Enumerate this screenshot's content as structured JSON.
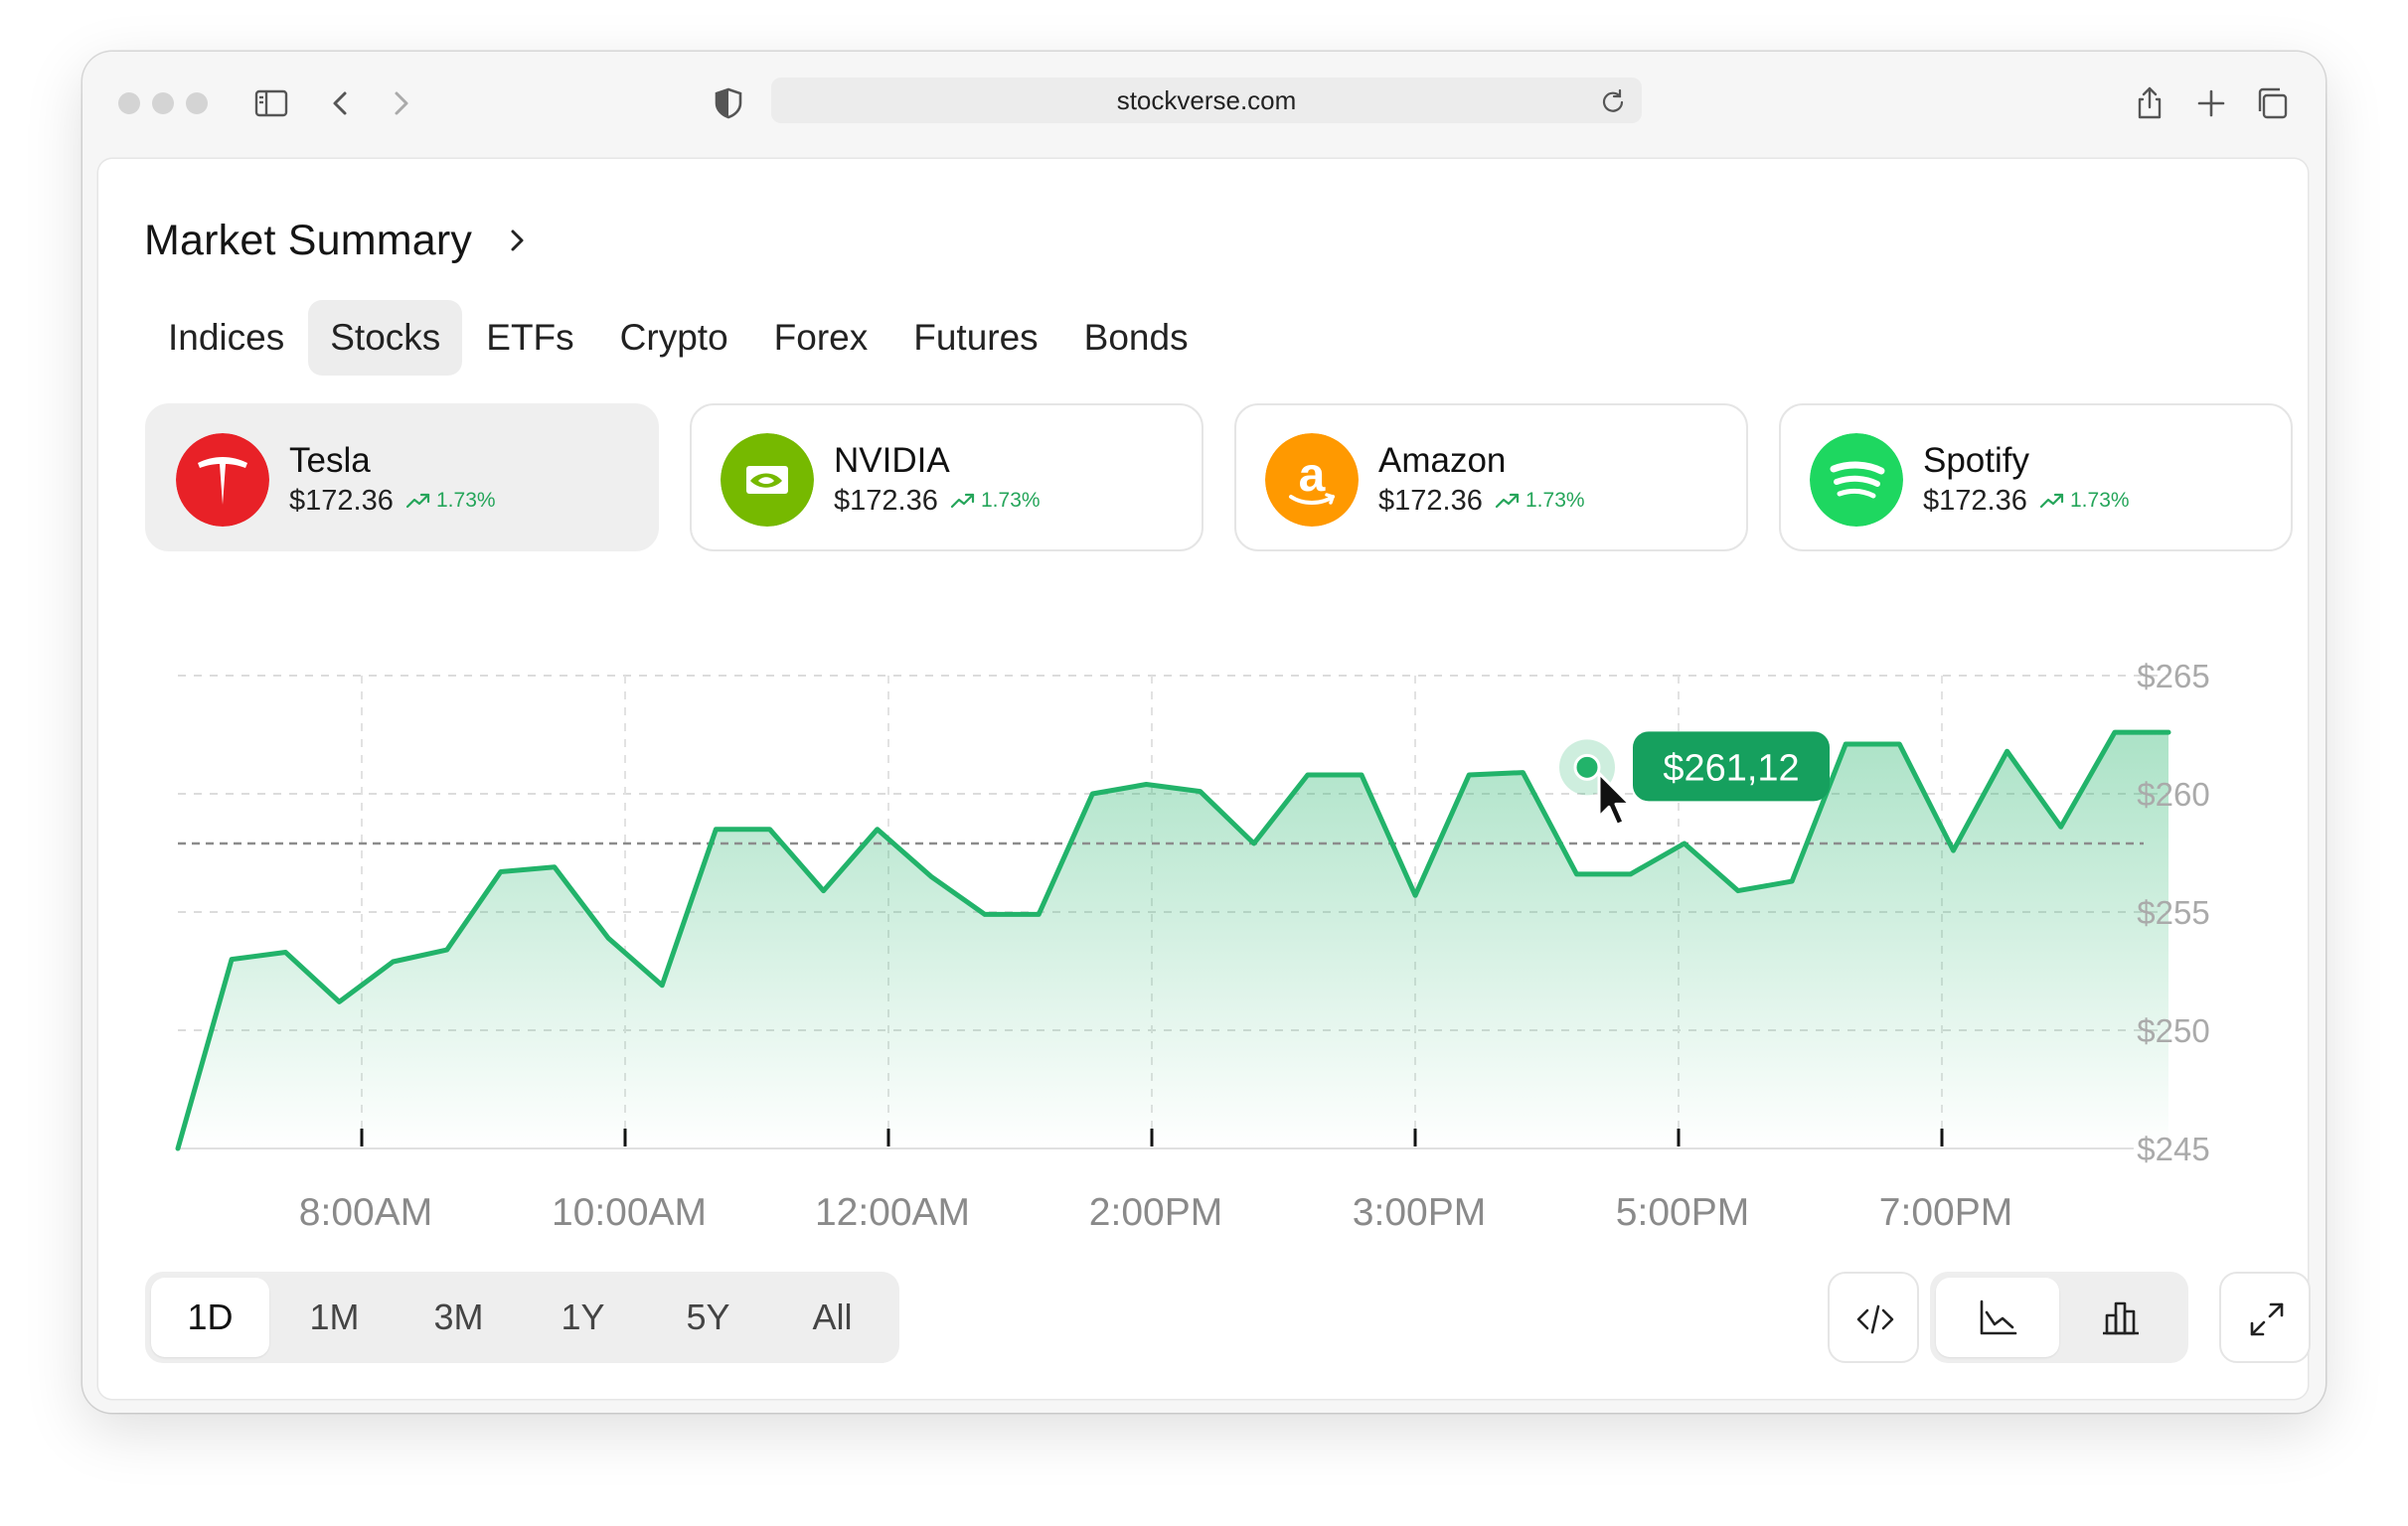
{
  "browser": {
    "url": "stockverse.com",
    "icons": [
      "sidebar-icon",
      "back-icon",
      "forward-icon",
      "shield-icon",
      "reload-icon",
      "share-icon",
      "new-tab-icon",
      "tabs-overview-icon"
    ]
  },
  "page": {
    "title": "Market Summary",
    "tabs": [
      {
        "label": "Indices",
        "active": false
      },
      {
        "label": "Stocks",
        "active": true
      },
      {
        "label": "ETFs",
        "active": false
      },
      {
        "label": "Crypto",
        "active": false
      },
      {
        "label": "Forex",
        "active": false
      },
      {
        "label": "Futures",
        "active": false
      },
      {
        "label": "Bonds",
        "active": false
      }
    ]
  },
  "stocks": [
    {
      "name": "Tesla",
      "price": "$172.36",
      "change": "1.73%",
      "logo": "tesla-logo",
      "color": "#e82127",
      "active": true
    },
    {
      "name": "NVIDIA",
      "price": "$172.36",
      "change": "1.73%",
      "logo": "nvidia-logo",
      "color": "#76b900",
      "active": false
    },
    {
      "name": "Amazon",
      "price": "$172.36",
      "change": "1.73%",
      "logo": "amazon-logo",
      "color": "#ff9900",
      "active": false
    },
    {
      "name": "Spotify",
      "price": "$172.36",
      "change": "1.73%",
      "logo": "spotify-logo",
      "color": "#1ed760",
      "active": false
    }
  ],
  "chart_data": {
    "type": "area",
    "ylim": [
      245,
      265
    ],
    "y_ticks": [
      "$265",
      "$260",
      "$255",
      "$250",
      "$245"
    ],
    "x_ticks": [
      "8:00AM",
      "10:00AM",
      "12:00AM",
      "2:00PM",
      "3:00PM",
      "5:00PM",
      "7:00PM"
    ],
    "series": [
      {
        "color": "#22b36a",
        "values": [
          245.0,
          253.0,
          253.3,
          251.2,
          252.9,
          253.4,
          256.7,
          256.9,
          253.9,
          251.9,
          258.5,
          258.5,
          255.9,
          258.5,
          256.5,
          254.9,
          254.9,
          260.0,
          260.4,
          260.1,
          257.9,
          260.8,
          260.8,
          255.7,
          260.8,
          260.9,
          256.6,
          256.6,
          257.9,
          255.9,
          256.3,
          262.1,
          262.1,
          257.6,
          261.8,
          258.6,
          262.6,
          262.6
        ]
      }
    ],
    "reference_line": 257.9,
    "grid": true,
    "tooltip": {
      "label": "$261,12",
      "value": 261.12
    }
  },
  "controls": {
    "ranges": [
      {
        "label": "1D",
        "active": true
      },
      {
        "label": "1M",
        "active": false
      },
      {
        "label": "3M",
        "active": false
      },
      {
        "label": "1Y",
        "active": false
      },
      {
        "label": "5Y",
        "active": false
      },
      {
        "label": "All",
        "active": false
      }
    ],
    "tools": [
      "embed-code-icon",
      "line-chart-icon",
      "bar-chart-icon",
      "expand-icon"
    ],
    "active_view": "line-chart"
  }
}
